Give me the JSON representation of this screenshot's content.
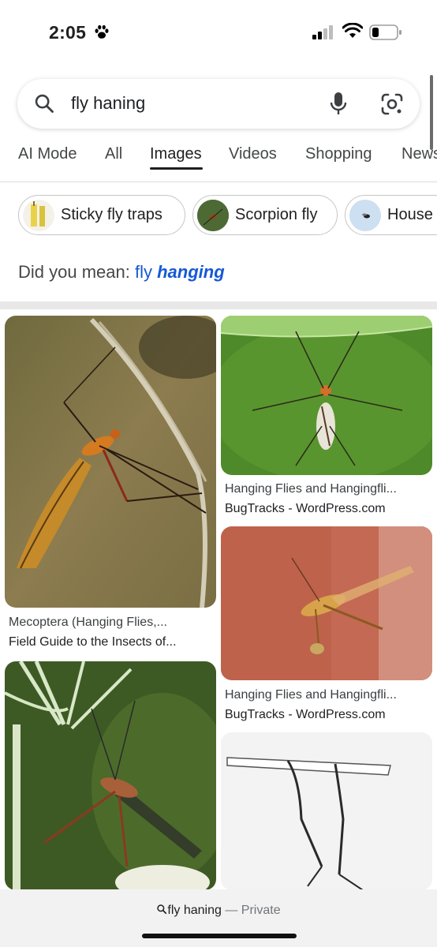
{
  "status": {
    "time": "2:05",
    "icons": [
      "paw-icon",
      "cellular-signal-icon",
      "wifi-icon",
      "battery-icon"
    ]
  },
  "search": {
    "query": "fly haning",
    "icons": [
      "search-icon",
      "mic-icon",
      "google-lens-icon"
    ]
  },
  "tabs": [
    {
      "label": "AI Mode"
    },
    {
      "label": "All"
    },
    {
      "label": "Images",
      "active": true
    },
    {
      "label": "Videos"
    },
    {
      "label": "Shopping"
    },
    {
      "label": "News"
    }
  ],
  "chips": [
    {
      "label": "Sticky fly traps"
    },
    {
      "label": "Scorpion fly"
    },
    {
      "label": "House"
    }
  ],
  "did_you_mean": {
    "prefix": "Did you mean:",
    "plain": "fly",
    "emphasis": "hanging"
  },
  "results": [
    {
      "title": "Mecoptera (Hanging Flies,...",
      "source": "Field Guide to the Insects of..."
    },
    {
      "title": "Hanging Flies and Hangingfli...",
      "source": "BugTracks - WordPress.com"
    },
    {
      "title": "Hanging Flies and Hangingfli...",
      "source": "BugTracks - WordPress.com"
    }
  ],
  "bottom": {
    "query": "fly haning",
    "separator": "—",
    "mode": "Private"
  },
  "colors": {
    "link_blue": "#1558d6",
    "tab_text": "#444746",
    "chip_border": "#c4c7c5"
  }
}
